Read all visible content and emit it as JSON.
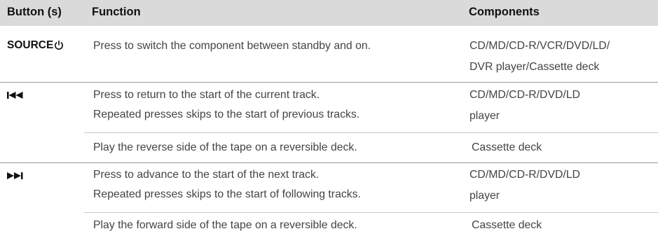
{
  "header": {
    "col_button": "Button (s)",
    "col_function": "Function",
    "col_components": "Components"
  },
  "rows": [
    {
      "button_label": "SOURCE",
      "button_icon": "power-icon",
      "function": [
        "Press to switch the component between standby and on."
      ],
      "components": [
        "CD/MD/CD-R/VCR/DVD/LD/",
        "DVR player/Cassette deck"
      ]
    },
    {
      "button_icon": "skip-back-icon",
      "function": [
        "Press to return to the start of the current track.",
        "Repeated presses skips to the start of previous tracks."
      ],
      "components": [
        "CD/MD/CD-R/DVD/LD",
        "player"
      ]
    },
    {
      "function": [
        "Play the reverse side of the tape on a reversible deck."
      ],
      "components": [
        "Cassette deck"
      ]
    },
    {
      "button_icon": "skip-forward-icon",
      "function": [
        "Press to advance to the start of the next track.",
        "Repeated presses skips to the start of following tracks."
      ],
      "components": [
        "CD/MD/CD-R/DVD/LD",
        "player"
      ]
    },
    {
      "function": [
        "Play the forward side of the tape on a reversible deck."
      ],
      "components": [
        "Cassette deck"
      ]
    }
  ]
}
